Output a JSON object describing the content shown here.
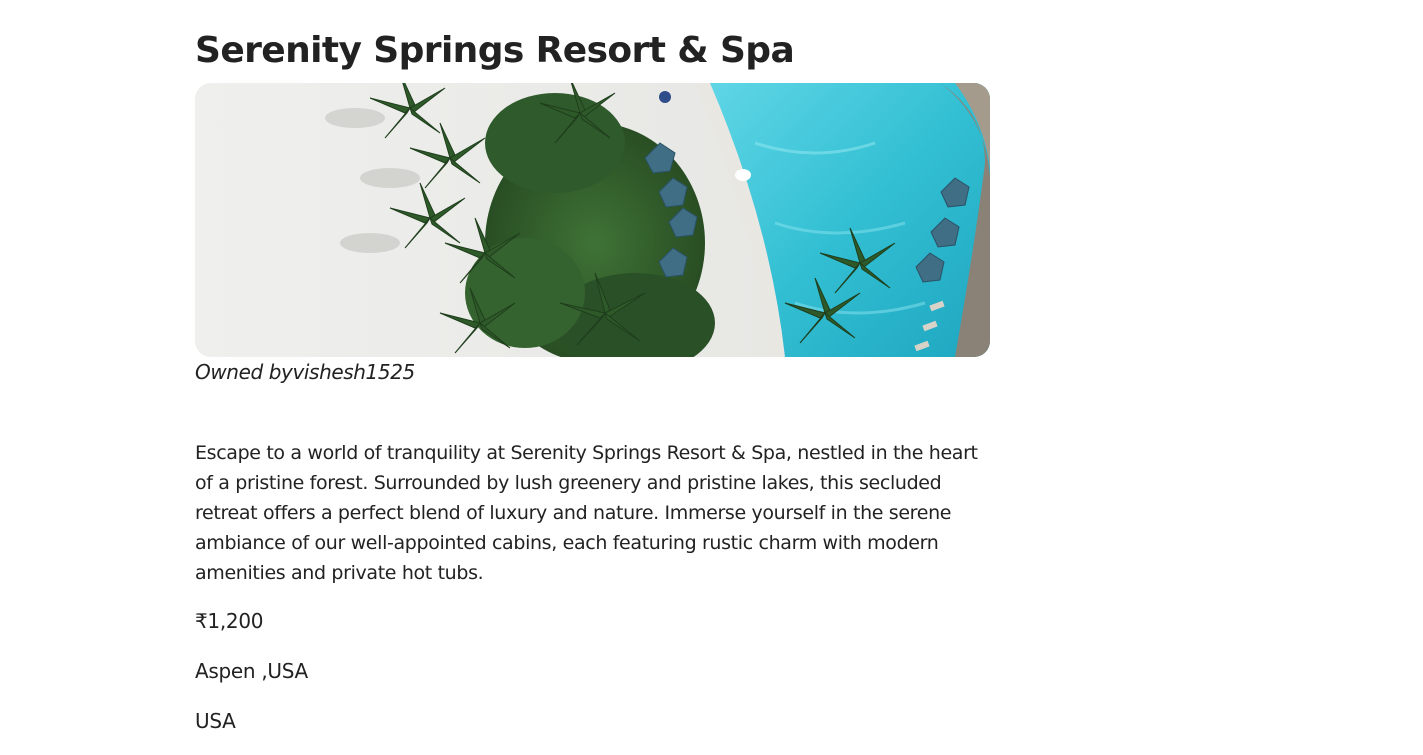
{
  "listing": {
    "title": "Serenity Springs Resort & Spa",
    "image_alt": "Aerial view of beach, palm trees and pool",
    "owner_prefix": "Owned by",
    "owner_username": "vishesh1525",
    "description": "Escape to a world of tranquility at Serenity Springs Resort & Spa, nestled in the heart of a pristine forest. Surrounded by lush greenery and pristine lakes, this secluded retreat offers a perfect blend of luxury and nature. Immerse yourself in the serene ambiance of our well-appointed cabins, each featuring rustic charm with modern amenities and private hot tubs.",
    "price": "₹1,200",
    "location": "Aspen ,USA",
    "country": "USA"
  },
  "colors": {
    "text": "#222222",
    "sand": "#ececea",
    "pool": "#3cc4d6",
    "foliage": "#2f5a2c",
    "umbrella": "#3f6e85"
  }
}
